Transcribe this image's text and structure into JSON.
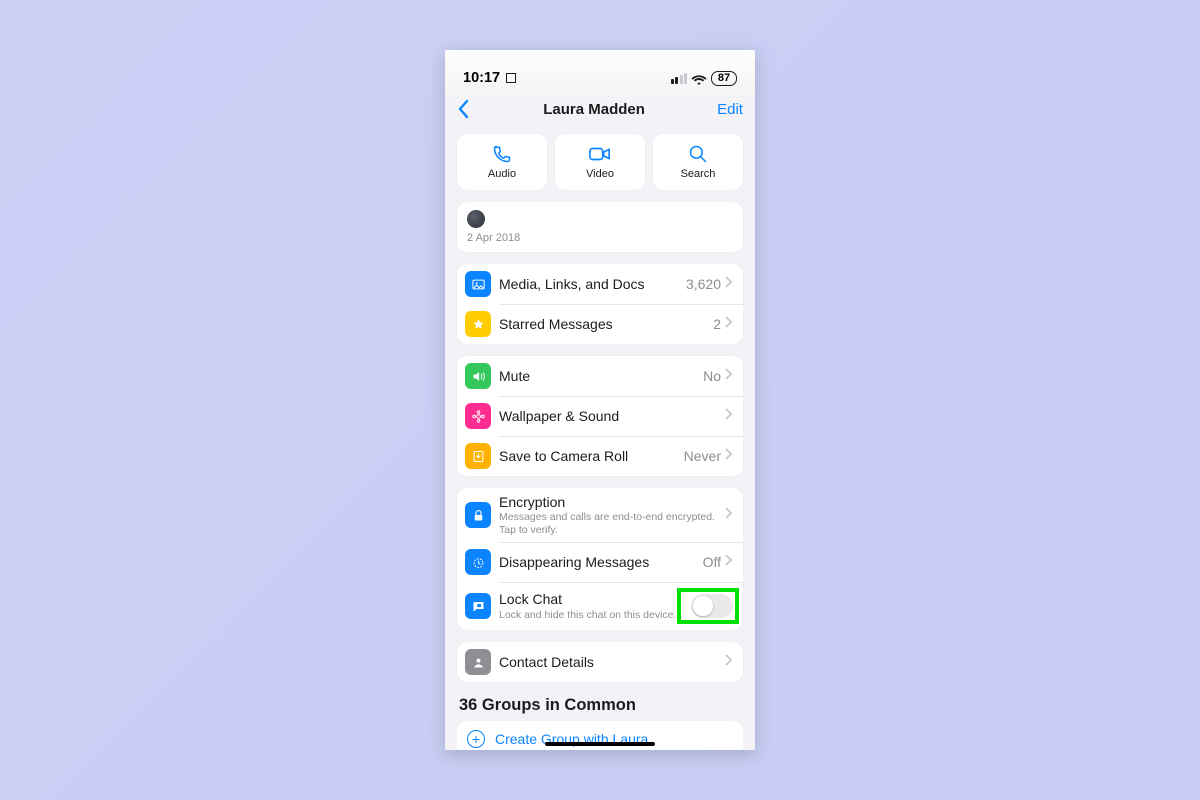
{
  "statusbar": {
    "time": "10:17",
    "battery": "87"
  },
  "nav": {
    "title": "Laura Madden",
    "edit": "Edit"
  },
  "actions": {
    "audio": "Audio",
    "video": "Video",
    "search": "Search"
  },
  "datecard": {
    "date": "2 Apr 2018"
  },
  "groupA": {
    "media": {
      "label": "Media, Links, and Docs",
      "count": "3,620"
    },
    "starred": {
      "label": "Starred Messages",
      "count": "2"
    }
  },
  "groupB": {
    "mute": {
      "label": "Mute",
      "value": "No"
    },
    "wallpaper": {
      "label": "Wallpaper & Sound"
    },
    "camroll": {
      "label": "Save to Camera Roll",
      "value": "Never"
    }
  },
  "groupC": {
    "encryption": {
      "label": "Encryption",
      "sub": "Messages and calls are end-to-end encrypted. Tap to verify."
    },
    "disappearing": {
      "label": "Disappearing Messages",
      "value": "Off"
    },
    "lock": {
      "label": "Lock Chat",
      "sub": "Lock and hide this chat on this device."
    }
  },
  "contact": {
    "label": "Contact Details"
  },
  "groupsInCommon": {
    "title": "36 Groups in Common",
    "create": "Create Group with Laura"
  },
  "colors": {
    "ios_blue": "#0a84ff",
    "highlight_green": "#00e000"
  }
}
